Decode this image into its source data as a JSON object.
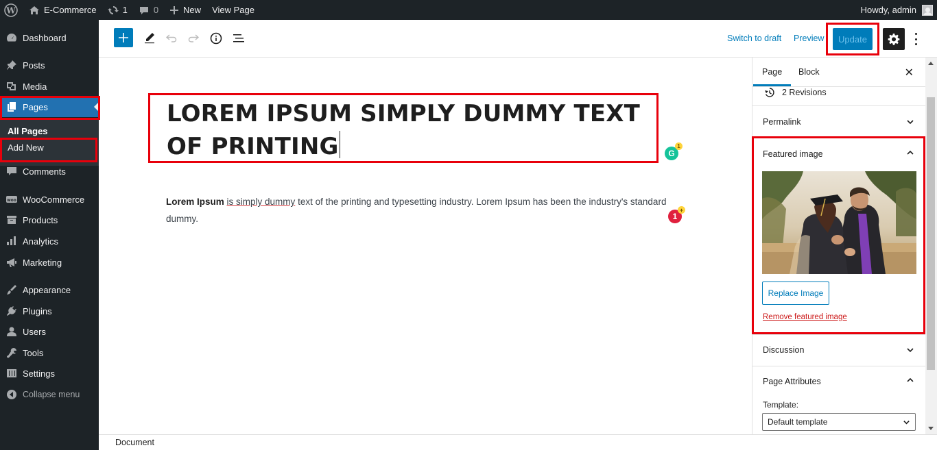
{
  "adminbar": {
    "site_name": "E-Commerce",
    "updates_count": "1",
    "comments_count": "0",
    "new_label": "New",
    "view_label": "View Page",
    "greeting": "Howdy, admin"
  },
  "sidebar": {
    "items": [
      {
        "label": "Dashboard",
        "icon": "dashboard-icon"
      },
      {
        "label": "Posts",
        "icon": "pin-icon"
      },
      {
        "label": "Media",
        "icon": "media-icon"
      },
      {
        "label": "Pages",
        "icon": "pages-icon"
      },
      {
        "label": "Comments",
        "icon": "comment-icon"
      },
      {
        "label": "WooCommerce",
        "icon": "woo-icon"
      },
      {
        "label": "Products",
        "icon": "archive-icon"
      },
      {
        "label": "Analytics",
        "icon": "chart-bar-icon"
      },
      {
        "label": "Marketing",
        "icon": "megaphone-icon"
      },
      {
        "label": "Appearance",
        "icon": "brush-icon"
      },
      {
        "label": "Plugins",
        "icon": "plug-icon"
      },
      {
        "label": "Users",
        "icon": "user-icon"
      },
      {
        "label": "Tools",
        "icon": "wrench-icon"
      },
      {
        "label": "Settings",
        "icon": "sliders-icon"
      }
    ],
    "submenu": [
      "All Pages",
      "Add New"
    ],
    "collapse_label": "Collapse menu"
  },
  "toolbar": {
    "switch_draft": "Switch to draft",
    "preview": "Preview",
    "update": "Update"
  },
  "editor": {
    "title": "LOREM IPSUM SIMPLY DUMMY TEXT OF PRINTING",
    "paragraph_bold": "Lorem Ipsum",
    "paragraph_underlined": "is simply dummy",
    "paragraph_rest": "text of the printing and typesetting industry. Lorem Ipsum has been the industry's standard dummy.",
    "grammarly_count": "1",
    "issue_count": "1"
  },
  "panel": {
    "tab_page": "Page",
    "tab_block": "Block",
    "revisions": "2 Revisions",
    "permalink": "Permalink",
    "featured_image": "Featured image",
    "replace_image": "Replace Image",
    "remove_image": "Remove featured image",
    "discussion": "Discussion",
    "page_attributes": "Page Attributes",
    "template_label": "Template:",
    "template_value": "Default template"
  },
  "footer": {
    "breadcrumb": "Document"
  },
  "colors": {
    "accent": "#007cba",
    "admin_dark": "#1d2327",
    "highlight": "#e8000b",
    "danger": "#cc1818"
  }
}
